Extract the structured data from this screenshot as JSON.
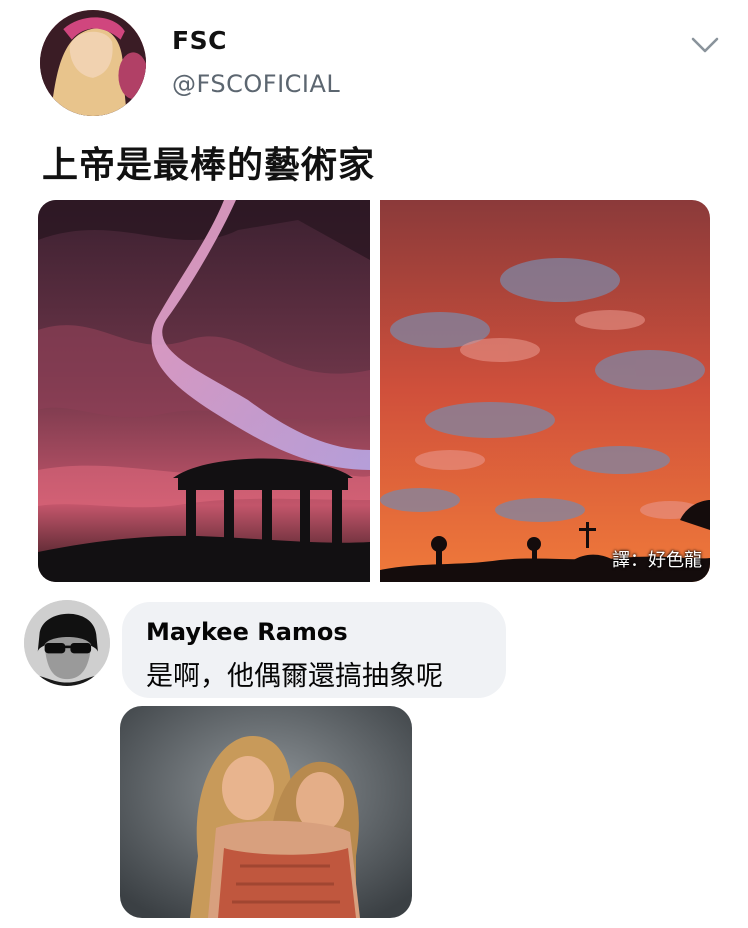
{
  "post": {
    "author_name": "FSC",
    "author_handle": "@FSCOFICIAL",
    "text": "上帝是最棒的藝術家",
    "images": [
      {
        "subject": "pink swirling sky over gazebo silhouette"
      },
      {
        "subject": "red clouded sunset sky with silhouettes"
      }
    ],
    "watermark": "譯：好色龍",
    "menu_icon": "chevron-down-icon"
  },
  "comment": {
    "commenter_name": "Maykee Ramos",
    "text": "是啊，他偶爾還搞抽象呢",
    "attached_image": {
      "subject": "photo of two smiling girls"
    }
  },
  "colors": {
    "background": "#ffffff",
    "handle": "#5c6670",
    "bubble": "#f0f2f5"
  }
}
